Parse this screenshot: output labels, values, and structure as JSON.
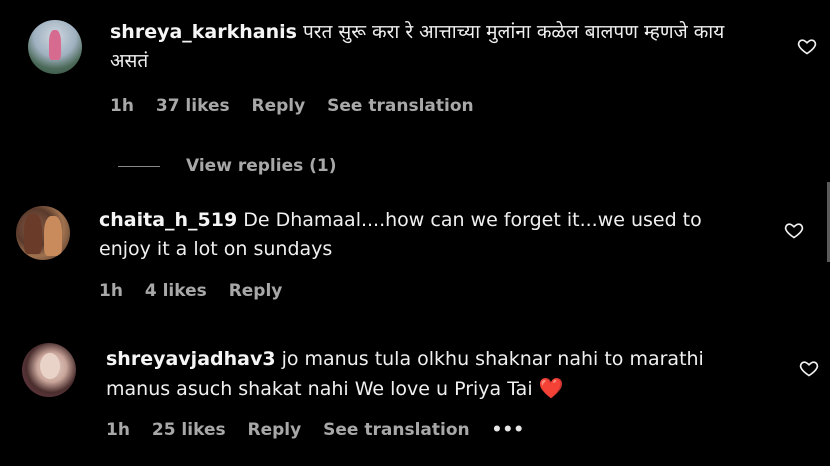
{
  "comments": [
    {
      "username": "shreya_karkhanis",
      "text": "परत सुरू करा रे आत्ताच्या मुलांना कळेल बालपण म्हणजे काय असतं",
      "time": "1h",
      "likes": "37 likes",
      "reply": "Reply",
      "translate": "See translation"
    },
    {
      "username": "chaita_h_519",
      "text": "De Dhamaal....how can we forget it...we used to enjoy it a lot on sundays",
      "time": "1h",
      "likes": "4 likes",
      "reply": "Reply"
    },
    {
      "username": "shreyavjadhav3",
      "text": "jo manus tula olkhu shaknar nahi to marathi manus asuch shakat nahi We love u Priya Tai",
      "emoji": "❤️",
      "time": "1h",
      "likes": "25 likes",
      "reply": "Reply",
      "translate": "See translation",
      "more": "•••"
    }
  ],
  "view_replies": "View replies (1)",
  "colors": {
    "background": "#000000",
    "muted": "#a8a8a8",
    "heart_red": "#e0245e"
  }
}
